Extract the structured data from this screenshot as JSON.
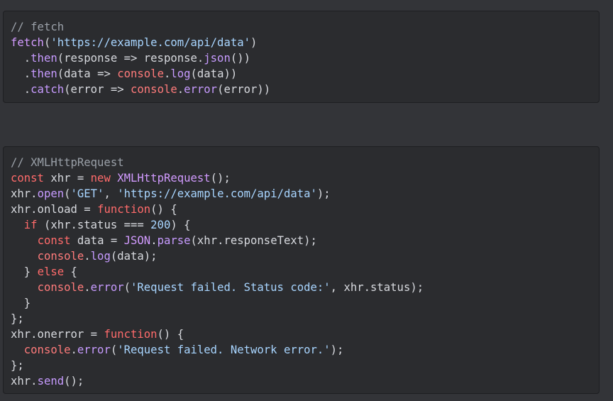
{
  "colors": {
    "background": "#333438",
    "block_background": "#2b2c2f",
    "comment": "#9aa0a8",
    "keyword": "#ff6b6b",
    "builtin": "#d29bff",
    "string": "#a8d5ff",
    "plain": "#d8dadf"
  },
  "blocks": [
    {
      "lines": [
        [
          {
            "t": "comment",
            "v": "// fetch"
          }
        ],
        [
          {
            "t": "builtin",
            "v": "fetch"
          },
          {
            "t": "plain",
            "v": "("
          },
          {
            "t": "string",
            "v": "'https://example.com/api/data'"
          },
          {
            "t": "plain",
            "v": ")"
          }
        ],
        [
          {
            "t": "plain",
            "v": "  ."
          },
          {
            "t": "method",
            "v": "then"
          },
          {
            "t": "plain",
            "v": "(response => response."
          },
          {
            "t": "method",
            "v": "json"
          },
          {
            "t": "plain",
            "v": "())"
          }
        ],
        [
          {
            "t": "plain",
            "v": "  ."
          },
          {
            "t": "method",
            "v": "then"
          },
          {
            "t": "plain",
            "v": "(data => "
          },
          {
            "t": "console",
            "v": "console"
          },
          {
            "t": "plain",
            "v": "."
          },
          {
            "t": "method",
            "v": "log"
          },
          {
            "t": "plain",
            "v": "(data))"
          }
        ],
        [
          {
            "t": "plain",
            "v": "  ."
          },
          {
            "t": "method",
            "v": "catch"
          },
          {
            "t": "plain",
            "v": "(error => "
          },
          {
            "t": "console",
            "v": "console"
          },
          {
            "t": "plain",
            "v": "."
          },
          {
            "t": "method",
            "v": "error"
          },
          {
            "t": "plain",
            "v": "(error))"
          }
        ]
      ]
    },
    {
      "lines": [
        [
          {
            "t": "comment",
            "v": "// XMLHttpRequest"
          }
        ],
        [
          {
            "t": "keyword",
            "v": "const"
          },
          {
            "t": "plain",
            "v": " xhr = "
          },
          {
            "t": "keyword",
            "v": "new"
          },
          {
            "t": "plain",
            "v": " "
          },
          {
            "t": "builtin",
            "v": "XMLHttpRequest"
          },
          {
            "t": "plain",
            "v": "();"
          }
        ],
        [
          {
            "t": "plain",
            "v": "xhr."
          },
          {
            "t": "method",
            "v": "open"
          },
          {
            "t": "plain",
            "v": "("
          },
          {
            "t": "string",
            "v": "'GET'"
          },
          {
            "t": "plain",
            "v": ", "
          },
          {
            "t": "string",
            "v": "'https://example.com/api/data'"
          },
          {
            "t": "plain",
            "v": ");"
          }
        ],
        [
          {
            "t": "plain",
            "v": "xhr.onload = "
          },
          {
            "t": "keyword",
            "v": "function"
          },
          {
            "t": "plain",
            "v": "() {"
          }
        ],
        [
          {
            "t": "plain",
            "v": "  "
          },
          {
            "t": "keyword",
            "v": "if"
          },
          {
            "t": "plain",
            "v": " (xhr.status === "
          },
          {
            "t": "number",
            "v": "200"
          },
          {
            "t": "plain",
            "v": ") {"
          }
        ],
        [
          {
            "t": "plain",
            "v": "    "
          },
          {
            "t": "keyword",
            "v": "const"
          },
          {
            "t": "plain",
            "v": " data = "
          },
          {
            "t": "builtin",
            "v": "JSON"
          },
          {
            "t": "plain",
            "v": "."
          },
          {
            "t": "method",
            "v": "parse"
          },
          {
            "t": "plain",
            "v": "(xhr.responseText);"
          }
        ],
        [
          {
            "t": "plain",
            "v": "    "
          },
          {
            "t": "console",
            "v": "console"
          },
          {
            "t": "plain",
            "v": "."
          },
          {
            "t": "method",
            "v": "log"
          },
          {
            "t": "plain",
            "v": "(data);"
          }
        ],
        [
          {
            "t": "plain",
            "v": "  } "
          },
          {
            "t": "keyword",
            "v": "else"
          },
          {
            "t": "plain",
            "v": " {"
          }
        ],
        [
          {
            "t": "plain",
            "v": "    "
          },
          {
            "t": "console",
            "v": "console"
          },
          {
            "t": "plain",
            "v": "."
          },
          {
            "t": "method",
            "v": "error"
          },
          {
            "t": "plain",
            "v": "("
          },
          {
            "t": "string",
            "v": "'Request failed. Status code:'"
          },
          {
            "t": "plain",
            "v": ", xhr.status);"
          }
        ],
        [
          {
            "t": "plain",
            "v": "  }"
          }
        ],
        [
          {
            "t": "plain",
            "v": "};"
          }
        ],
        [
          {
            "t": "plain",
            "v": "xhr.onerror = "
          },
          {
            "t": "keyword",
            "v": "function"
          },
          {
            "t": "plain",
            "v": "() {"
          }
        ],
        [
          {
            "t": "plain",
            "v": "  "
          },
          {
            "t": "console",
            "v": "console"
          },
          {
            "t": "plain",
            "v": "."
          },
          {
            "t": "method",
            "v": "error"
          },
          {
            "t": "plain",
            "v": "("
          },
          {
            "t": "string",
            "v": "'Request failed. Network error.'"
          },
          {
            "t": "plain",
            "v": ");"
          }
        ],
        [
          {
            "t": "plain",
            "v": "};"
          }
        ],
        [
          {
            "t": "plain",
            "v": "xhr."
          },
          {
            "t": "method",
            "v": "send"
          },
          {
            "t": "plain",
            "v": "();"
          }
        ]
      ]
    }
  ]
}
